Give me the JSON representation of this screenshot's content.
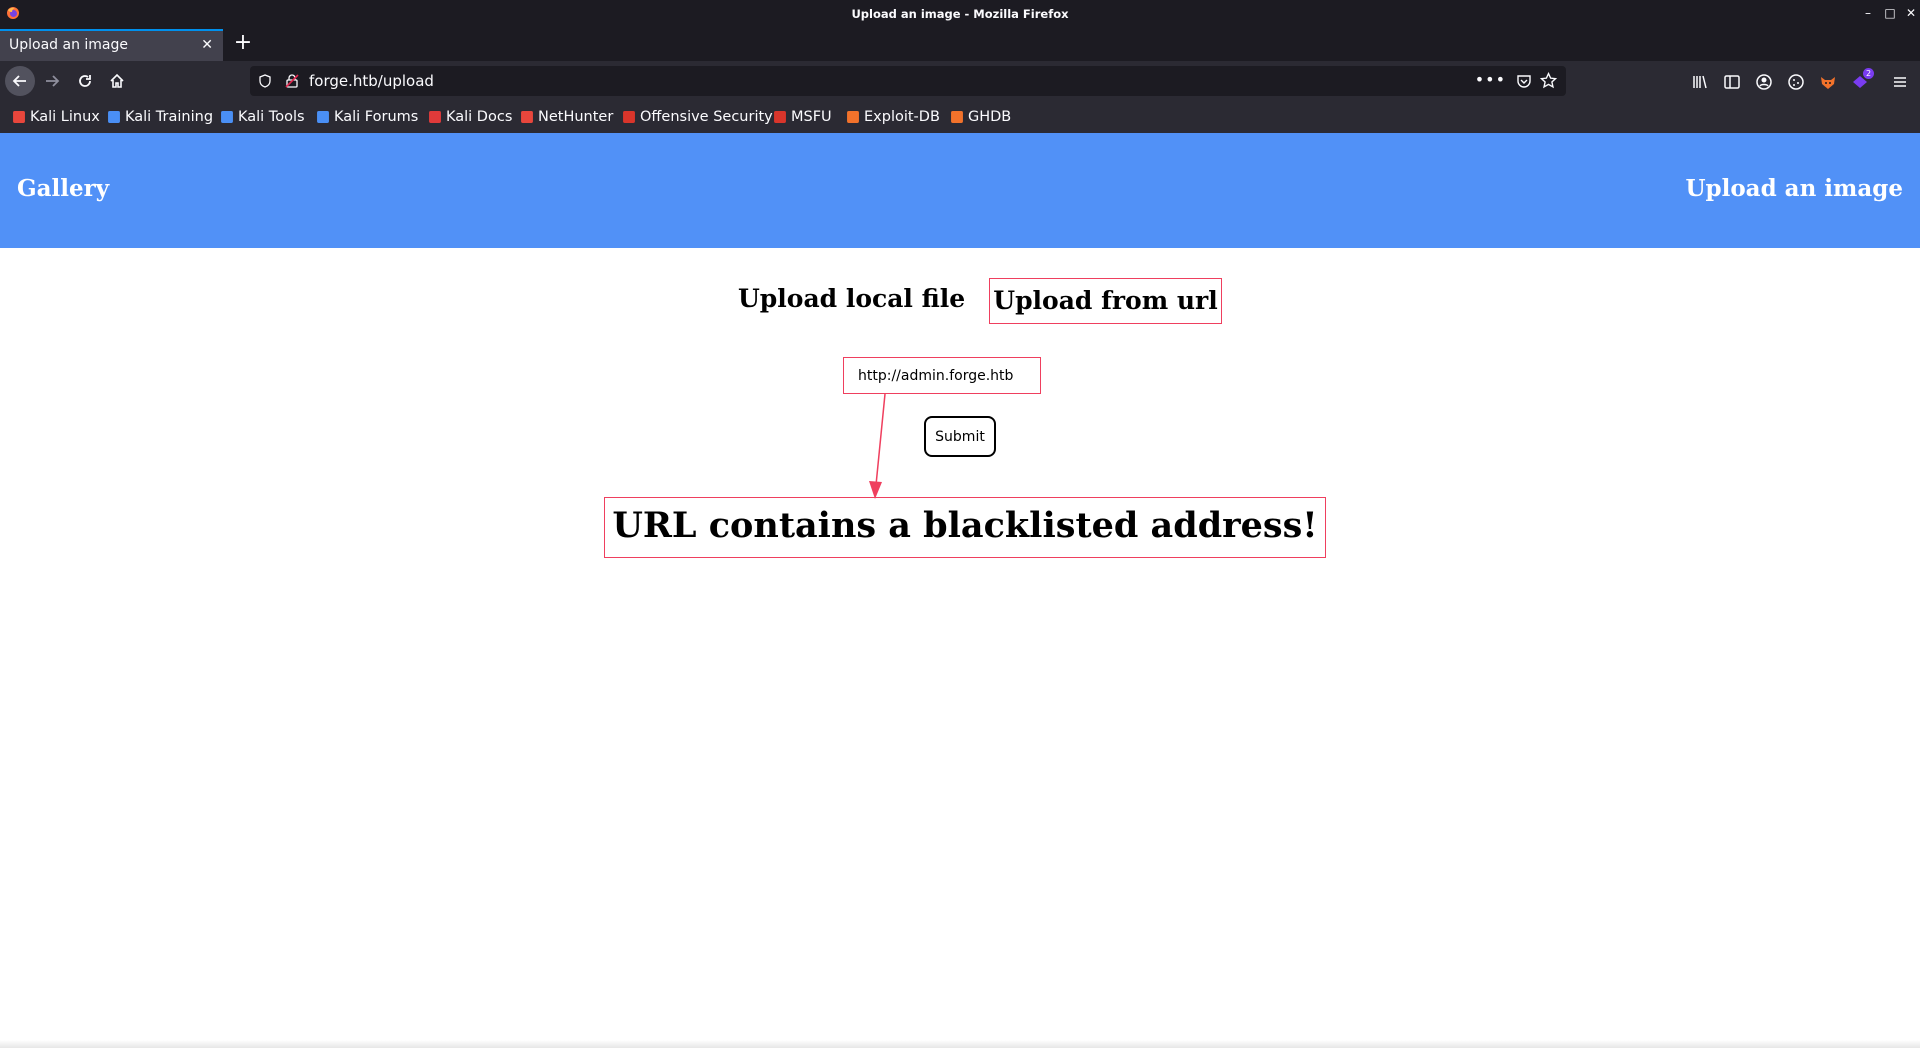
{
  "window": {
    "title": "Upload an image - Mozilla Firefox",
    "controls": [
      "minimize-icon",
      "maximize-icon",
      "close-icon"
    ]
  },
  "tabs": [
    {
      "label": "Upload an image",
      "active": true
    }
  ],
  "toolbar": {
    "url": "forge.htb/upload",
    "more_label": "•••",
    "extension_badge": "2",
    "accent_color": "#0090ed"
  },
  "bookmarks": [
    {
      "label": "Kali Linux",
      "icon": "kali-dragon-icon",
      "color": "#e8463c"
    },
    {
      "label": "Kali Training",
      "icon": "kali-blue-icon",
      "color": "#4a8ff5"
    },
    {
      "label": "Kali Tools",
      "icon": "kali-blue-icon",
      "color": "#4a8ff5"
    },
    {
      "label": "Kali Forums",
      "icon": "kali-blue-icon",
      "color": "#4a8ff5"
    },
    {
      "label": "Kali Docs",
      "icon": "kali-docs-icon",
      "color": "#e03a3a"
    },
    {
      "label": "NetHunter",
      "icon": "kali-dragon-icon",
      "color": "#e8463c"
    },
    {
      "label": "Offensive Security",
      "icon": "offsec-icon",
      "color": "#d9352b"
    },
    {
      "label": "MSFU",
      "icon": "msfu-icon",
      "color": "#d9352b"
    },
    {
      "label": "Exploit-DB",
      "icon": "exploitdb-icon",
      "color": "#f2722b"
    },
    {
      "label": "GHDB",
      "icon": "ghdb-icon",
      "color": "#f2722b"
    }
  ],
  "site": {
    "brand": "Gallery",
    "nav_link": "Upload an image",
    "header_color": "#5191f7"
  },
  "upload": {
    "tab_local": "Upload local file",
    "tab_url": "Upload from url",
    "url_value": "http://admin.forge.htb",
    "submit_label": "Submit",
    "error_message": "URL contains a blacklisted address!",
    "annotation_color": "#ef3f5e"
  }
}
